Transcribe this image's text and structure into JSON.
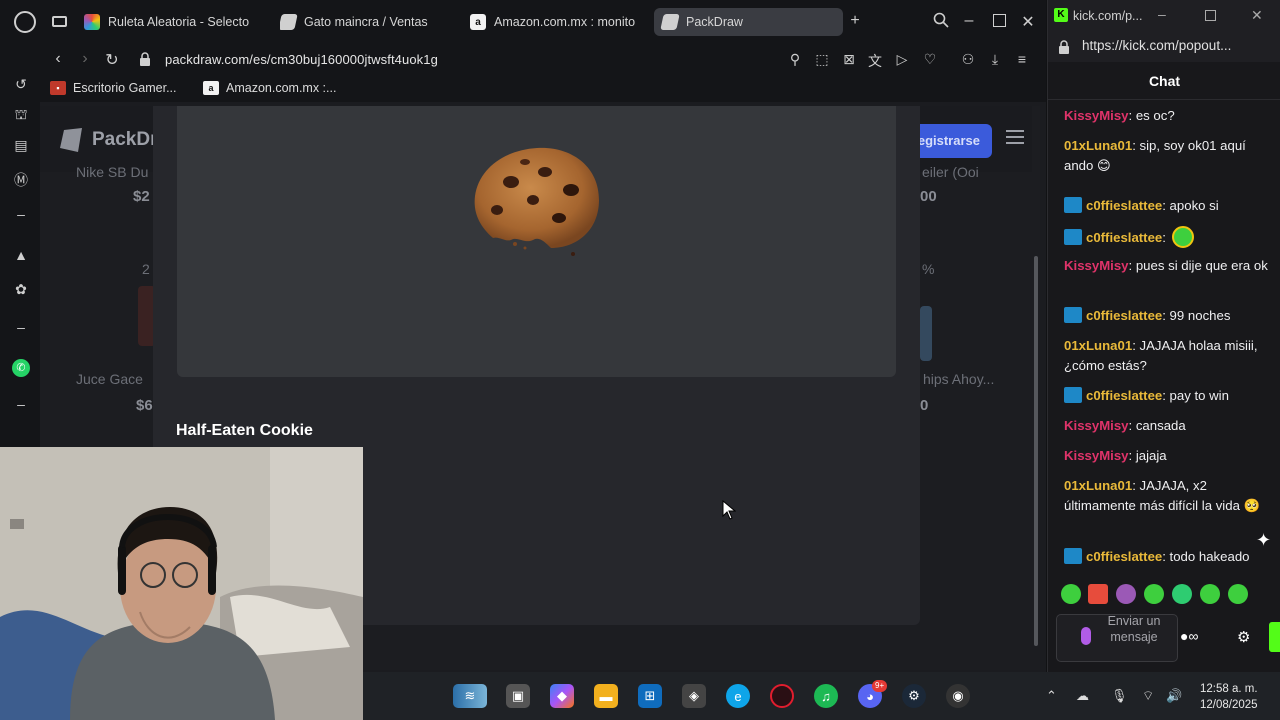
{
  "browser": {
    "tabs": [
      {
        "label": "Ruleta Aleatoria - Selecto",
        "active": false
      },
      {
        "label": "Gato maincra / Ventas",
        "active": false
      },
      {
        "label": "Amazon.com.mx : monito",
        "active": false
      },
      {
        "label": "PackDraw",
        "active": true
      }
    ],
    "new_tab_label": "+",
    "url": "packdraw.com/es/cm30buj160000jtwsft4uok1g",
    "bookmarks": [
      "Escritorio Gamer...",
      "Amazon.com.mx :..."
    ]
  },
  "page": {
    "logo_text": "PackDr",
    "register_label": "egistrarse",
    "bg_cards": [
      {
        "name": "Nike SB Du",
        "price": "$2"
      },
      {
        "name": "Juce Gace",
        "price": "$6"
      },
      {
        "name": "eiler (Ooi",
        "price": "00"
      },
      {
        "name": "hips Ahoy...",
        "price": "0"
      }
    ],
    "bg_odds": [
      "2",
      "%"
    ],
    "item_title": "Half-Eaten Cookie"
  },
  "chat": {
    "window_url": "kick.com/p...",
    "address_url": "https://kick.com/popout...",
    "header": "Chat",
    "messages": [
      {
        "user": "KissyMisy",
        "color": "#e0336a",
        "badge": false,
        "text": ": es oc?"
      },
      {
        "user": "01xLuna01",
        "color": "#e9b93a",
        "badge": false,
        "text": ": sip, soy ok01 aquí ando 😊"
      },
      {
        "user": "c0ffieslattee",
        "color": "#e9b93a",
        "badge": true,
        "text": ": apoko si"
      },
      {
        "user": "c0ffieslattee",
        "color": "#e9b93a",
        "badge": true,
        "text": ":"
      },
      {
        "user": "KissyMisy",
        "color": "#e0336a",
        "badge": false,
        "text": ": pues si dije que era ok"
      },
      {
        "user": "c0ffieslattee",
        "color": "#e9b93a",
        "badge": true,
        "text": ": 99 noches"
      },
      {
        "user": "01xLuna01",
        "color": "#e9b93a",
        "badge": false,
        "text": ": JAJAJA holaa misiii, ¿cómo estás?"
      },
      {
        "user": "c0ffieslattee",
        "color": "#e9b93a",
        "badge": true,
        "text": ": pay to win"
      },
      {
        "user": "KissyMisy",
        "color": "#e0336a",
        "badge": false,
        "text": ": cansada"
      },
      {
        "user": "KissyMisy",
        "color": "#e0336a",
        "badge": false,
        "text": ": jajaja"
      },
      {
        "user": "01xLuna01",
        "color": "#e9b93a",
        "badge": false,
        "text": ": JAJAJA, x2 últimamente más difícil la vida 🥺"
      },
      {
        "user": "c0ffieslattee",
        "color": "#e9b93a",
        "badge": true,
        "text": ": todo hakeado"
      }
    ],
    "input_placeholder": "Enviar un mensaje"
  },
  "taskbar": {
    "time": "12:58 a. m.",
    "date": "12/08/2025",
    "discord_badge": "9+"
  }
}
